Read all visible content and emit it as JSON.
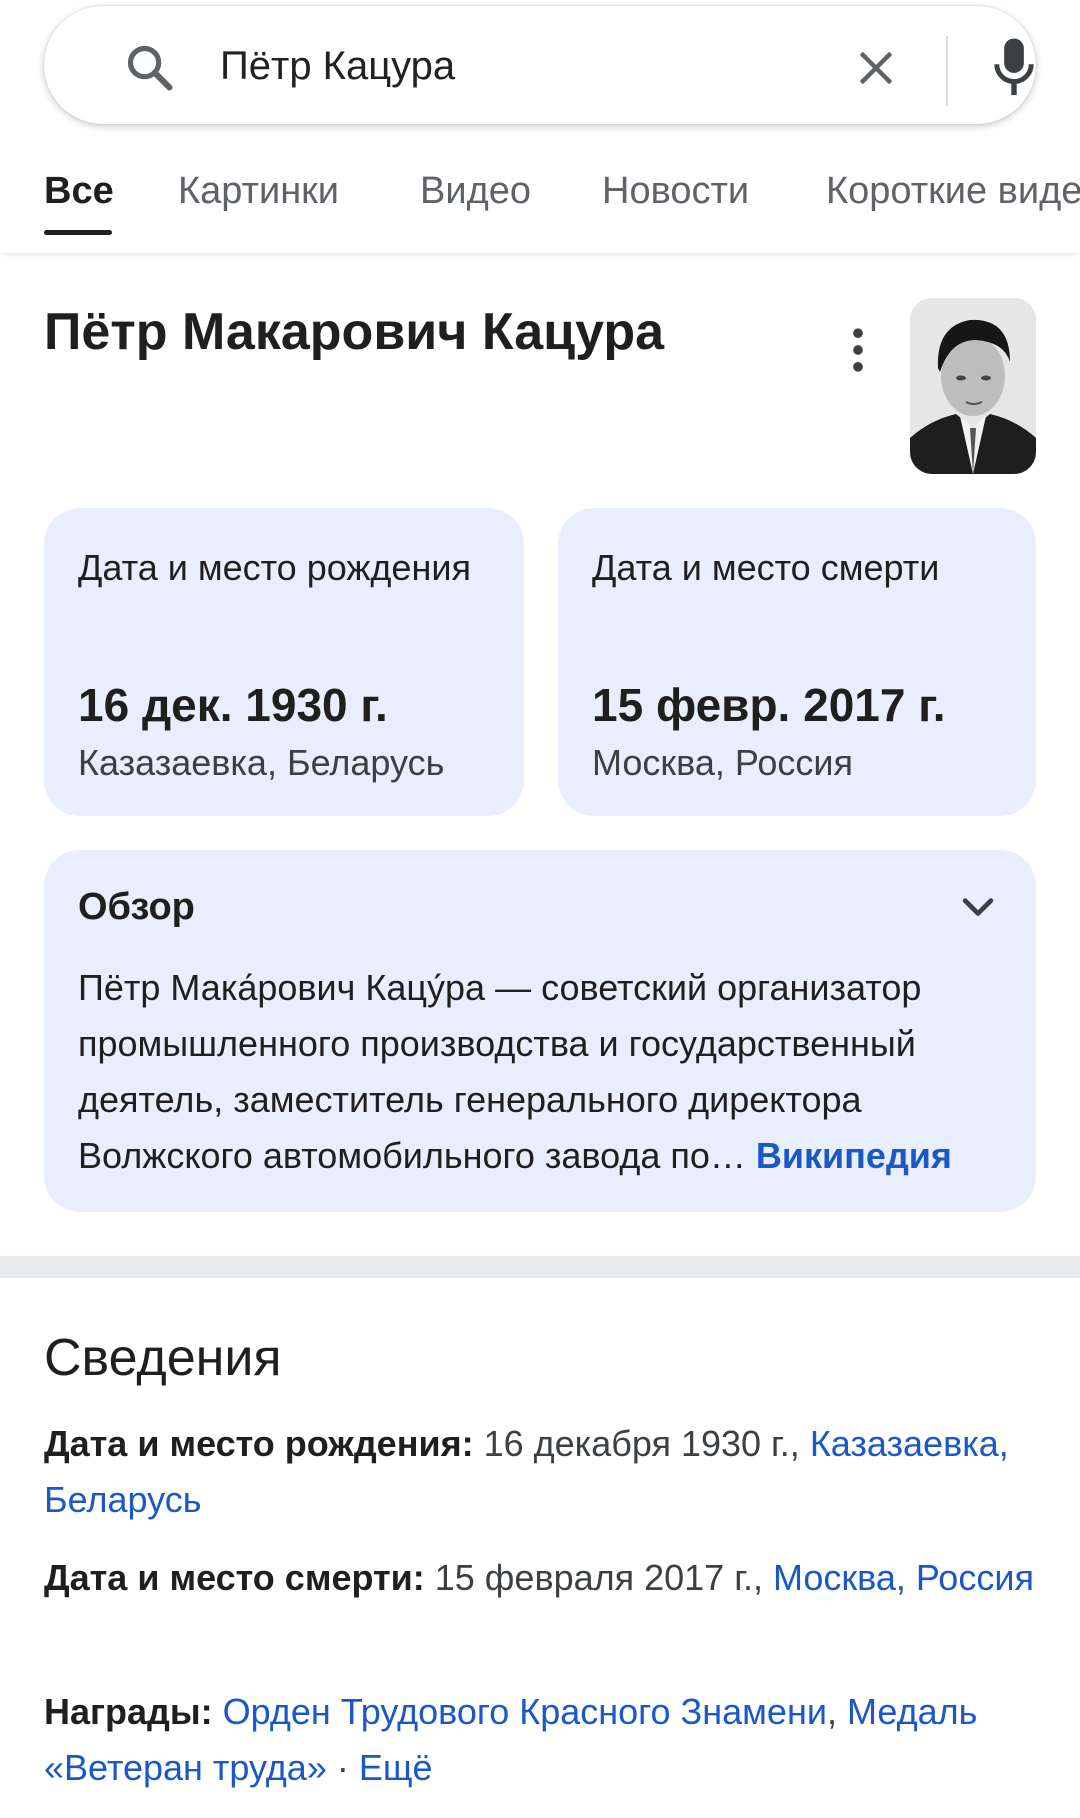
{
  "search": {
    "query": "Пётр Кацура"
  },
  "tabs": [
    {
      "label": "Все"
    },
    {
      "label": "Картинки"
    },
    {
      "label": "Видео"
    },
    {
      "label": "Новости"
    },
    {
      "label": "Короткие видео"
    }
  ],
  "entity": {
    "title": "Пётр Макарович Кацура"
  },
  "birth_card": {
    "label": "Дата и место рождения",
    "date": "16 дек. 1930 г.",
    "place": "Казазаевка, Беларусь"
  },
  "death_card": {
    "label": "Дата и место смерти",
    "date": "15 февр. 2017 г.",
    "place": "Москва, Россия"
  },
  "overview": {
    "title": "Обзор",
    "text": "Пётр Мака́рович Кацу́ра — советский организатор промышленного производства и государственный деятель, заместитель генерального директора Волжского автомобильного завода по",
    "ellipsis": "…",
    "source": "Википедия"
  },
  "details": {
    "title": "Сведения",
    "birth": {
      "label": "Дата и место рождения:",
      "value": "16 декабря 1930 г.,",
      "link": "Казазаевка, Беларусь"
    },
    "death": {
      "label": "Дата и место смерти:",
      "value": "15 февраля 2017 г.,",
      "link": "Москва, Россия"
    },
    "awards": {
      "label": "Награды:",
      "link1": "Орден Трудового Красного Знамени",
      "sep1": ",",
      "link2": "Медаль «Ветеран труда»",
      "sep2": " · ",
      "more": "Ещё"
    }
  },
  "colors": {
    "card_bg": "#e8eefc",
    "link": "#1a57c9",
    "text": "#1f1f1f"
  }
}
